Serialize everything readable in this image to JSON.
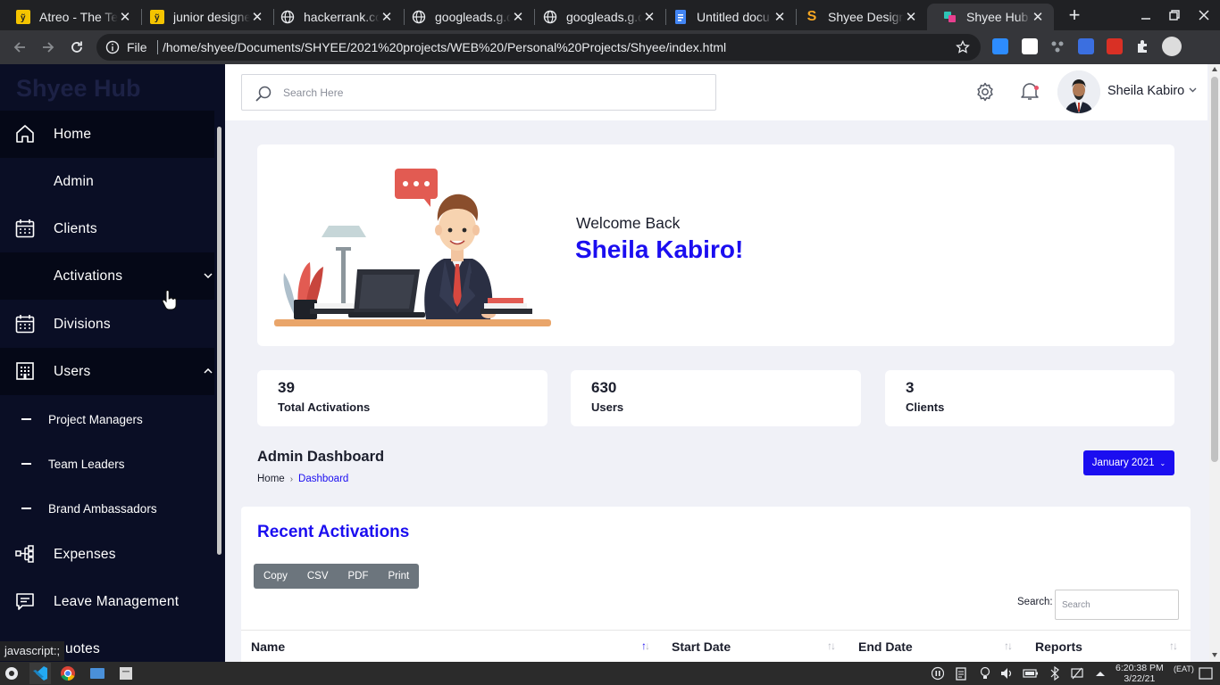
{
  "browser": {
    "tabs": [
      {
        "title": "Atreo - The Te",
        "favicon": "yellow-logo-icon"
      },
      {
        "title": "junior designe",
        "favicon": "yellow-logo-icon"
      },
      {
        "title": "hackerrank.co",
        "favicon": "globe-icon"
      },
      {
        "title": "googleads.g.d",
        "favicon": "globe-icon"
      },
      {
        "title": "googleads.g.d",
        "favicon": "globe-icon"
      },
      {
        "title": "Untitled docu",
        "favicon": "docs-icon"
      },
      {
        "title": "Shyee Design",
        "favicon": "s-logo-icon"
      },
      {
        "title": "Shyee Hub",
        "favicon": "shyee-hub-icon"
      }
    ],
    "omnibox": {
      "scheme_label": "File",
      "url": "/home/shyee/Documents/SHYEE/2021%20projects/WEB%20/Personal%20Projects/Shyee/index.html"
    },
    "status_text": "javascript:;"
  },
  "app": {
    "brand": "Shyee Hub",
    "sidebar": {
      "items": [
        {
          "label": "Home",
          "icon": "home-icon"
        },
        {
          "label": "Admin",
          "icon": ""
        },
        {
          "label": "Clients",
          "icon": "calendar-icon"
        },
        {
          "label": "Activations",
          "icon": "",
          "expandable": true
        },
        {
          "label": "Divisions",
          "icon": "calendar-icon"
        },
        {
          "label": "Users",
          "icon": "building-icon",
          "expanded": true
        },
        {
          "label": "Expenses",
          "icon": "flow-icon"
        },
        {
          "label": "Leave Management",
          "icon": "chat-icon"
        },
        {
          "label": "uotes",
          "icon": ""
        }
      ],
      "sub_items": [
        "Project Managers",
        "Team Leaders",
        "Brand Ambassadors"
      ]
    },
    "header": {
      "search_placeholder": "Search Here",
      "user_name": "Sheila Kabiro"
    },
    "welcome": {
      "greeting": "Welcome Back",
      "name": "Sheila Kabiro!"
    },
    "stats": [
      {
        "value": "39",
        "label": "Total Activations"
      },
      {
        "value": "630",
        "label": "Users"
      },
      {
        "value": "3",
        "label": "Clients"
      }
    ],
    "dashboard": {
      "title": "Admin Dashboard",
      "breadcrumb": [
        "Home",
        "Dashboard"
      ],
      "month_button": "January 2021"
    },
    "recent": {
      "title": "Recent Activations",
      "export_buttons": [
        "Copy",
        "CSV",
        "PDF",
        "Print"
      ],
      "search_label": "Search:",
      "search_placeholder": "Search",
      "columns": [
        "Name",
        "Start Date",
        "End Date",
        "Reports"
      ]
    }
  },
  "os": {
    "clock_time": "6:20:38 PM",
    "clock_date": "3/22/21",
    "timezone": "(EAT)"
  },
  "colors": {
    "accent": "#1b0ef0",
    "sidebar": "#0a0e25",
    "page_bg": "#f0f1f7"
  }
}
